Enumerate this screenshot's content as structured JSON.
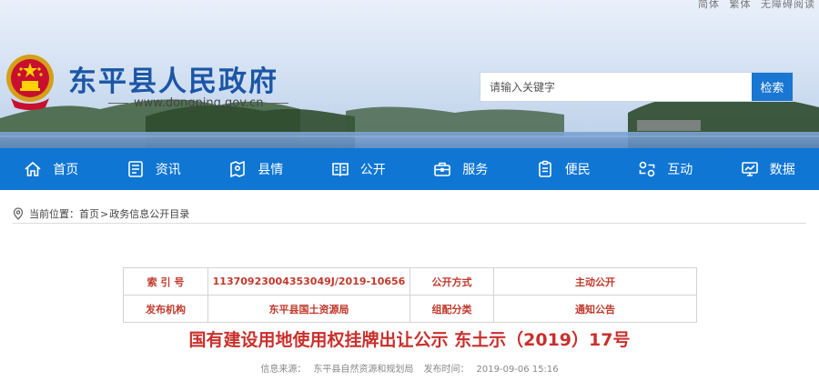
{
  "top_links": [
    "简体",
    "繁体",
    "无障碍阅读"
  ],
  "site": {
    "title": "东平县人民政府",
    "url": "www.dongping.gov.cn"
  },
  "search": {
    "placeholder": "请输入关键字",
    "button_label": "检索"
  },
  "nav": [
    {
      "label": "首页",
      "icon": "home-icon"
    },
    {
      "label": "资讯",
      "icon": "news-icon"
    },
    {
      "label": "县情",
      "icon": "county-map-icon"
    },
    {
      "label": "公开",
      "icon": "open-book-icon"
    },
    {
      "label": "服务",
      "icon": "briefcase-icon"
    },
    {
      "label": "便民",
      "icon": "clipboard-icon"
    },
    {
      "label": "互动",
      "icon": "interaction-icon"
    },
    {
      "label": "数据",
      "icon": "data-monitor-icon"
    }
  ],
  "breadcrumb": {
    "prefix": "当前位置：",
    "home": "首页",
    "sep": ">",
    "current": "政务信息公开目录"
  },
  "meta": {
    "index_label": "索 引 号",
    "index_value": "11370923004353049J/2019-10656",
    "disclosure_label": "公开方式",
    "disclosure_value": "主动公开",
    "publisher_label": "发布机构",
    "publisher_value": "东平县国土资源局",
    "category_label": "组配分类",
    "category_value": "通知公告"
  },
  "document": {
    "title": "国有建设用地使用权挂牌出让公示 东土示（2019）17号",
    "source_label": "信息来源：",
    "source_value": "东平县自然资源和规划局",
    "time_label": "发布时间：",
    "time_value": "2019-09-06 15:16"
  },
  "colors": {
    "brand_blue": "#1c56a6",
    "nav_blue": "#0f76d4",
    "search_button": "#1976d2",
    "title_red": "#c9302c"
  }
}
